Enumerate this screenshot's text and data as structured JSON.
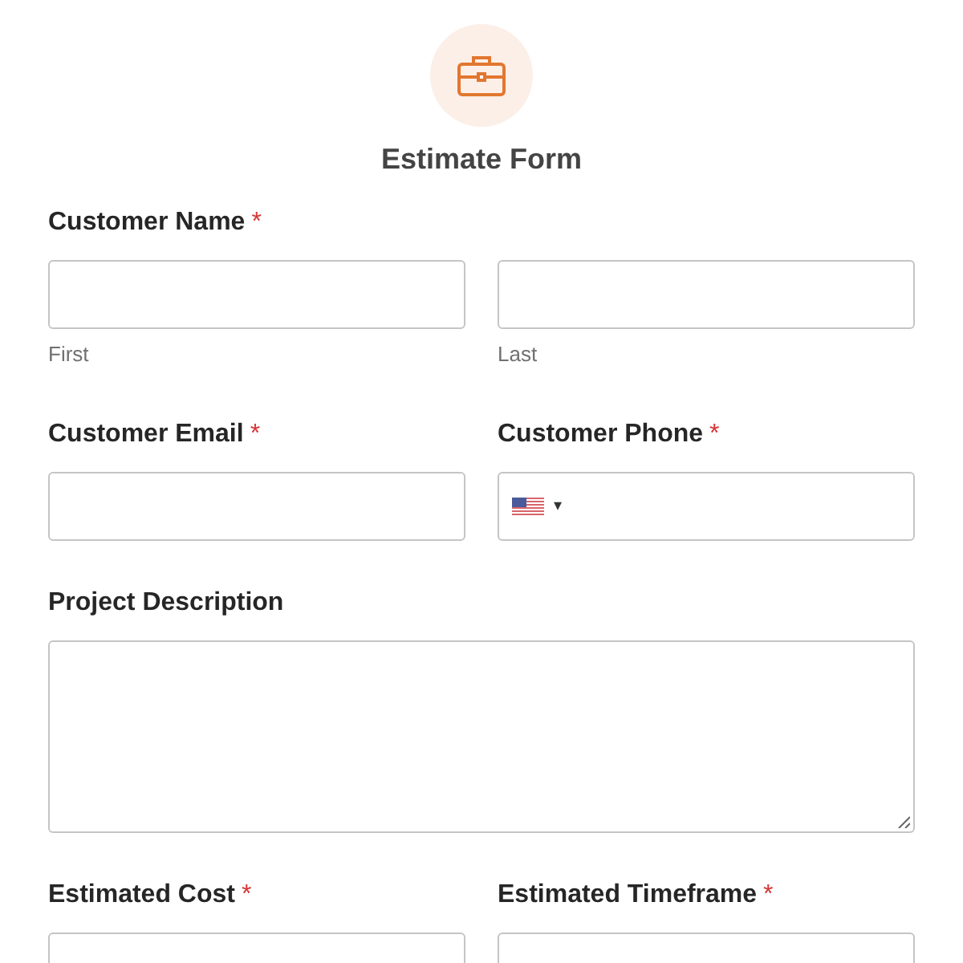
{
  "form": {
    "title": "Estimate Form"
  },
  "rows": [
    {
      "fields": [
        {
          "kind": "name",
          "label": "Customer Name",
          "mark": "*",
          "sublabels": [
            "First",
            "Last"
          ]
        }
      ]
    },
    {
      "fields": [
        {
          "kind": "text",
          "label": "Customer Email",
          "mark": "*"
        },
        {
          "kind": "phone",
          "label": "Customer Phone",
          "mark": "*",
          "caret": "▾"
        }
      ]
    },
    {
      "fields": [
        {
          "kind": "textarea",
          "label": "Project Description"
        }
      ]
    },
    {
      "fields": [
        {
          "kind": "text",
          "label": "Estimated Cost",
          "mark": "*"
        },
        {
          "kind": "text",
          "label": "Estimated Timeframe",
          "mark": "*"
        }
      ]
    }
  ]
}
